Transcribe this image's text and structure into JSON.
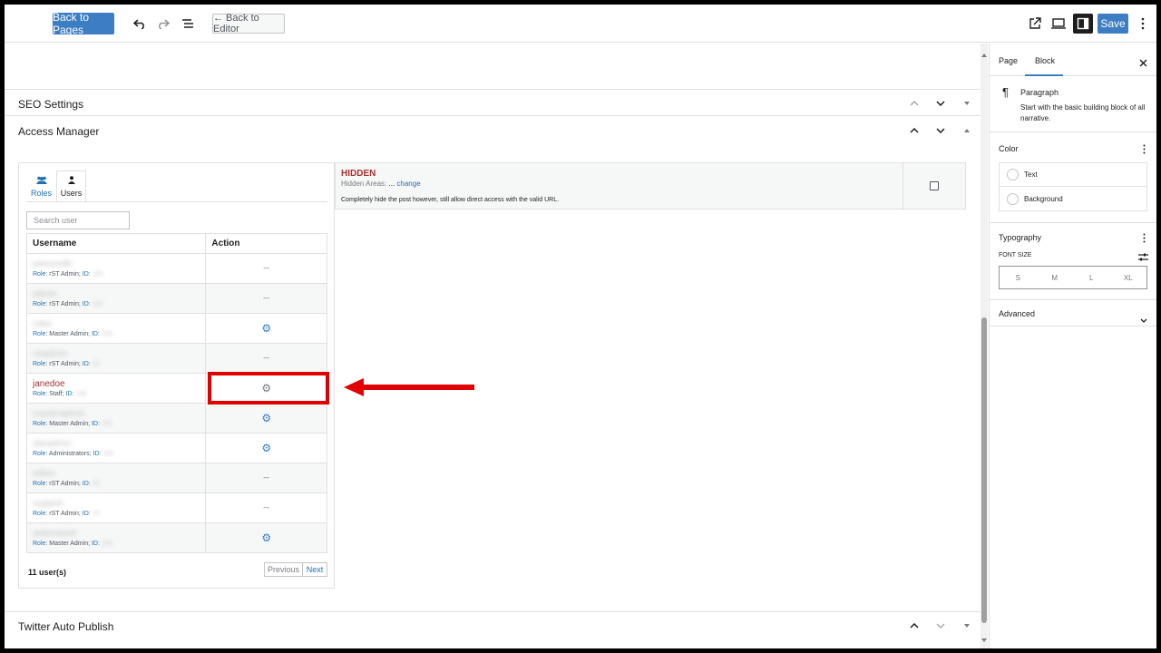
{
  "topbar": {
    "back_to_pages": "Back to Pages",
    "back_to_editor": "← Back to Editor",
    "save": "Save",
    "icons": [
      "undo-icon",
      "redo-icon",
      "list-view-icon",
      "external-link-icon",
      "preview-icon",
      "settings-icon",
      "more-options-icon"
    ]
  },
  "panels": {
    "seo": "SEO Settings",
    "access": "Access Manager",
    "twitter": "Twitter Auto Publish"
  },
  "access_manager": {
    "tabs": [
      {
        "label": "Roles",
        "icon": "users-icon"
      },
      {
        "label": "Users",
        "icon": "user-icon"
      }
    ],
    "search_placeholder": "Search user",
    "columns": [
      "Username",
      "Action"
    ],
    "role_label": "Role:",
    "id_label": "ID:",
    "rows": [
      {
        "username": "johnsmith",
        "role": "rST Admin",
        "id": "123",
        "action": "---"
      },
      {
        "username": "admin",
        "role": "rST Admin",
        "id": "124",
        "action": "---"
      },
      {
        "username": "mike",
        "role": "Master Admin",
        "id": "125",
        "action": "gear"
      },
      {
        "username": "rstadmin",
        "role": "rST Admin",
        "id": "12",
        "action": "---"
      },
      {
        "username": "janedoe",
        "role": "Staff",
        "id": "130",
        "action": "gear-grey",
        "highlighted": true
      },
      {
        "username": "masteradmin",
        "role": "Master Admin",
        "id": "131",
        "action": "gear"
      },
      {
        "username": "siteadmin",
        "role": "Administrators",
        "id": "132",
        "action": "gear"
      },
      {
        "username": "editor",
        "role": "rST Admin",
        "id": "13",
        "action": "---"
      },
      {
        "username": "support",
        "role": "rST Admin",
        "id": "14",
        "action": "---"
      },
      {
        "username": "webmaster",
        "role": "Master Admin",
        "id": "135",
        "action": "gear"
      }
    ],
    "user_count": "11 user(s)",
    "previous": "Previous",
    "next": "Next"
  },
  "hidden": {
    "title": "HIDDEN",
    "areas_label": "Hidden Areas:",
    "areas_value": "...",
    "change": "change",
    "description": "Completely hide the post however, still allow direct access with the valid URL."
  },
  "sidebar": {
    "tabs": [
      "Page",
      "Block"
    ],
    "active_tab": "Block",
    "block_name": "Paragraph",
    "block_desc": "Start with the basic building block of all narrative.",
    "color": {
      "title": "Color",
      "items": [
        "Text",
        "Background"
      ]
    },
    "typography": {
      "title": "Typography",
      "font_size_label": "FONT SIZE",
      "sizes": [
        "S",
        "M",
        "L",
        "XL"
      ]
    },
    "advanced": "Advanced"
  },
  "colors": {
    "accent": "#3c7dc4",
    "annotation": "#e00000",
    "hidden_title": "#a83232"
  }
}
